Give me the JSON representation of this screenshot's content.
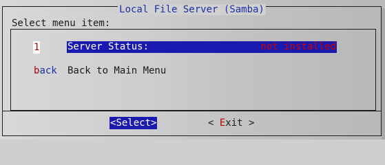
{
  "dialog": {
    "title": "Local File Server (Samba)",
    "prompt": "Select menu item:"
  },
  "menu": {
    "items": [
      {
        "tag": "1",
        "label": "Server Status:",
        "value": "not installed",
        "selected": true
      },
      {
        "tag_hot": "b",
        "tag_rest": "ack",
        "label": "Back to Main Menu",
        "selected": false
      }
    ]
  },
  "buttons": {
    "select_open": "<",
    "select_label": "Select",
    "select_close": ">",
    "exit_open": "< ",
    "exit_hot": "E",
    "exit_rest": "xit",
    "exit_close": " >"
  },
  "colors": {
    "title": "#1b2fa8",
    "highlight_bg": "#1a1ab0",
    "status_value": "#cc0000",
    "hotkey": "#b40000"
  }
}
